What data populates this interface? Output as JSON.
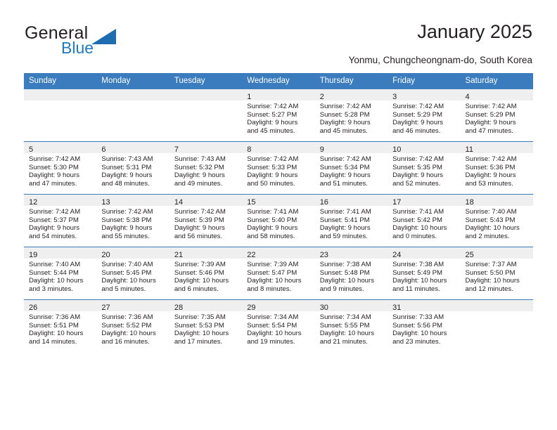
{
  "brand": {
    "name_part1": "General",
    "name_part2": "Blue"
  },
  "header": {
    "title": "January 2025",
    "location": "Yonmu, Chungcheongnam-do, South Korea"
  },
  "colors": {
    "header_blue": "#3a7cbe",
    "daynum_band": "#efefef",
    "brand_blue": "#1f7ac0",
    "text": "#231f20"
  },
  "weekday_headers": [
    "Sunday",
    "Monday",
    "Tuesday",
    "Wednesday",
    "Thursday",
    "Friday",
    "Saturday"
  ],
  "weeks": [
    [
      {
        "day": "",
        "sunrise": "",
        "sunset": "",
        "daylight_line1": "",
        "daylight_line2": ""
      },
      {
        "day": "",
        "sunrise": "",
        "sunset": "",
        "daylight_line1": "",
        "daylight_line2": ""
      },
      {
        "day": "",
        "sunrise": "",
        "sunset": "",
        "daylight_line1": "",
        "daylight_line2": ""
      },
      {
        "day": "1",
        "sunrise": "Sunrise: 7:42 AM",
        "sunset": "Sunset: 5:27 PM",
        "daylight_line1": "Daylight: 9 hours",
        "daylight_line2": "and 45 minutes."
      },
      {
        "day": "2",
        "sunrise": "Sunrise: 7:42 AM",
        "sunset": "Sunset: 5:28 PM",
        "daylight_line1": "Daylight: 9 hours",
        "daylight_line2": "and 45 minutes."
      },
      {
        "day": "3",
        "sunrise": "Sunrise: 7:42 AM",
        "sunset": "Sunset: 5:29 PM",
        "daylight_line1": "Daylight: 9 hours",
        "daylight_line2": "and 46 minutes."
      },
      {
        "day": "4",
        "sunrise": "Sunrise: 7:42 AM",
        "sunset": "Sunset: 5:29 PM",
        "daylight_line1": "Daylight: 9 hours",
        "daylight_line2": "and 47 minutes."
      }
    ],
    [
      {
        "day": "5",
        "sunrise": "Sunrise: 7:42 AM",
        "sunset": "Sunset: 5:30 PM",
        "daylight_line1": "Daylight: 9 hours",
        "daylight_line2": "and 47 minutes."
      },
      {
        "day": "6",
        "sunrise": "Sunrise: 7:43 AM",
        "sunset": "Sunset: 5:31 PM",
        "daylight_line1": "Daylight: 9 hours",
        "daylight_line2": "and 48 minutes."
      },
      {
        "day": "7",
        "sunrise": "Sunrise: 7:43 AM",
        "sunset": "Sunset: 5:32 PM",
        "daylight_line1": "Daylight: 9 hours",
        "daylight_line2": "and 49 minutes."
      },
      {
        "day": "8",
        "sunrise": "Sunrise: 7:42 AM",
        "sunset": "Sunset: 5:33 PM",
        "daylight_line1": "Daylight: 9 hours",
        "daylight_line2": "and 50 minutes."
      },
      {
        "day": "9",
        "sunrise": "Sunrise: 7:42 AM",
        "sunset": "Sunset: 5:34 PM",
        "daylight_line1": "Daylight: 9 hours",
        "daylight_line2": "and 51 minutes."
      },
      {
        "day": "10",
        "sunrise": "Sunrise: 7:42 AM",
        "sunset": "Sunset: 5:35 PM",
        "daylight_line1": "Daylight: 9 hours",
        "daylight_line2": "and 52 minutes."
      },
      {
        "day": "11",
        "sunrise": "Sunrise: 7:42 AM",
        "sunset": "Sunset: 5:36 PM",
        "daylight_line1": "Daylight: 9 hours",
        "daylight_line2": "and 53 minutes."
      }
    ],
    [
      {
        "day": "12",
        "sunrise": "Sunrise: 7:42 AM",
        "sunset": "Sunset: 5:37 PM",
        "daylight_line1": "Daylight: 9 hours",
        "daylight_line2": "and 54 minutes."
      },
      {
        "day": "13",
        "sunrise": "Sunrise: 7:42 AM",
        "sunset": "Sunset: 5:38 PM",
        "daylight_line1": "Daylight: 9 hours",
        "daylight_line2": "and 55 minutes."
      },
      {
        "day": "14",
        "sunrise": "Sunrise: 7:42 AM",
        "sunset": "Sunset: 5:39 PM",
        "daylight_line1": "Daylight: 9 hours",
        "daylight_line2": "and 56 minutes."
      },
      {
        "day": "15",
        "sunrise": "Sunrise: 7:41 AM",
        "sunset": "Sunset: 5:40 PM",
        "daylight_line1": "Daylight: 9 hours",
        "daylight_line2": "and 58 minutes."
      },
      {
        "day": "16",
        "sunrise": "Sunrise: 7:41 AM",
        "sunset": "Sunset: 5:41 PM",
        "daylight_line1": "Daylight: 9 hours",
        "daylight_line2": "and 59 minutes."
      },
      {
        "day": "17",
        "sunrise": "Sunrise: 7:41 AM",
        "sunset": "Sunset: 5:42 PM",
        "daylight_line1": "Daylight: 10 hours",
        "daylight_line2": "and 0 minutes."
      },
      {
        "day": "18",
        "sunrise": "Sunrise: 7:40 AM",
        "sunset": "Sunset: 5:43 PM",
        "daylight_line1": "Daylight: 10 hours",
        "daylight_line2": "and 2 minutes."
      }
    ],
    [
      {
        "day": "19",
        "sunrise": "Sunrise: 7:40 AM",
        "sunset": "Sunset: 5:44 PM",
        "daylight_line1": "Daylight: 10 hours",
        "daylight_line2": "and 3 minutes."
      },
      {
        "day": "20",
        "sunrise": "Sunrise: 7:40 AM",
        "sunset": "Sunset: 5:45 PM",
        "daylight_line1": "Daylight: 10 hours",
        "daylight_line2": "and 5 minutes."
      },
      {
        "day": "21",
        "sunrise": "Sunrise: 7:39 AM",
        "sunset": "Sunset: 5:46 PM",
        "daylight_line1": "Daylight: 10 hours",
        "daylight_line2": "and 6 minutes."
      },
      {
        "day": "22",
        "sunrise": "Sunrise: 7:39 AM",
        "sunset": "Sunset: 5:47 PM",
        "daylight_line1": "Daylight: 10 hours",
        "daylight_line2": "and 8 minutes."
      },
      {
        "day": "23",
        "sunrise": "Sunrise: 7:38 AM",
        "sunset": "Sunset: 5:48 PM",
        "daylight_line1": "Daylight: 10 hours",
        "daylight_line2": "and 9 minutes."
      },
      {
        "day": "24",
        "sunrise": "Sunrise: 7:38 AM",
        "sunset": "Sunset: 5:49 PM",
        "daylight_line1": "Daylight: 10 hours",
        "daylight_line2": "and 11 minutes."
      },
      {
        "day": "25",
        "sunrise": "Sunrise: 7:37 AM",
        "sunset": "Sunset: 5:50 PM",
        "daylight_line1": "Daylight: 10 hours",
        "daylight_line2": "and 12 minutes."
      }
    ],
    [
      {
        "day": "26",
        "sunrise": "Sunrise: 7:36 AM",
        "sunset": "Sunset: 5:51 PM",
        "daylight_line1": "Daylight: 10 hours",
        "daylight_line2": "and 14 minutes."
      },
      {
        "day": "27",
        "sunrise": "Sunrise: 7:36 AM",
        "sunset": "Sunset: 5:52 PM",
        "daylight_line1": "Daylight: 10 hours",
        "daylight_line2": "and 16 minutes."
      },
      {
        "day": "28",
        "sunrise": "Sunrise: 7:35 AM",
        "sunset": "Sunset: 5:53 PM",
        "daylight_line1": "Daylight: 10 hours",
        "daylight_line2": "and 17 minutes."
      },
      {
        "day": "29",
        "sunrise": "Sunrise: 7:34 AM",
        "sunset": "Sunset: 5:54 PM",
        "daylight_line1": "Daylight: 10 hours",
        "daylight_line2": "and 19 minutes."
      },
      {
        "day": "30",
        "sunrise": "Sunrise: 7:34 AM",
        "sunset": "Sunset: 5:55 PM",
        "daylight_line1": "Daylight: 10 hours",
        "daylight_line2": "and 21 minutes."
      },
      {
        "day": "31",
        "sunrise": "Sunrise: 7:33 AM",
        "sunset": "Sunset: 5:56 PM",
        "daylight_line1": "Daylight: 10 hours",
        "daylight_line2": "and 23 minutes."
      },
      {
        "day": "",
        "sunrise": "",
        "sunset": "",
        "daylight_line1": "",
        "daylight_line2": ""
      }
    ]
  ]
}
